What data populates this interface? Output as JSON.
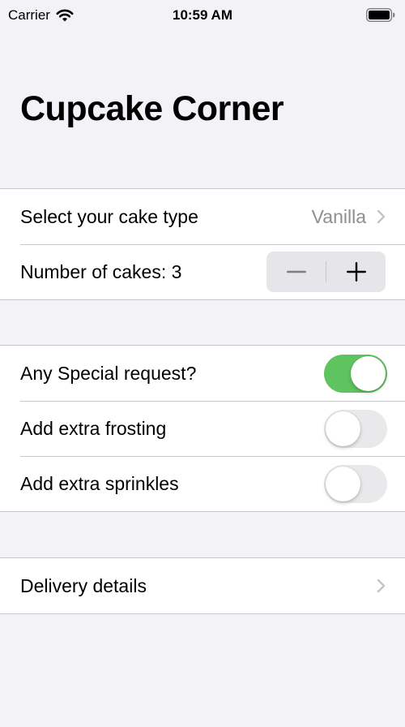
{
  "status_bar": {
    "carrier": "Carrier",
    "time": "10:59 AM",
    "icons": [
      "wifi-icon",
      "battery-icon"
    ]
  },
  "navigation": {
    "title": "Cupcake Corner"
  },
  "order_section": {
    "cake_type_label": "Select your cake type",
    "cake_type_value": "Vanilla",
    "quantity_label": "Number of cakes: 3",
    "quantity": 3,
    "stepper_icons": [
      "minus-icon",
      "plus-icon"
    ]
  },
  "extras_section": {
    "special_request_label": "Any Special request?",
    "special_request_on": true,
    "frosting_label": "Add extra frosting",
    "frosting_on": false,
    "sprinkles_label": "Add extra sprinkles",
    "sprinkles_on": false
  },
  "delivery_section": {
    "delivery_label": "Delivery details"
  },
  "colors": {
    "background": "#f2f2f7",
    "toggle_on": "#5fc35f",
    "toggle_off": "#e9e9eb",
    "secondary_text": "#8e8e93",
    "separator": "#c8c7cc"
  }
}
